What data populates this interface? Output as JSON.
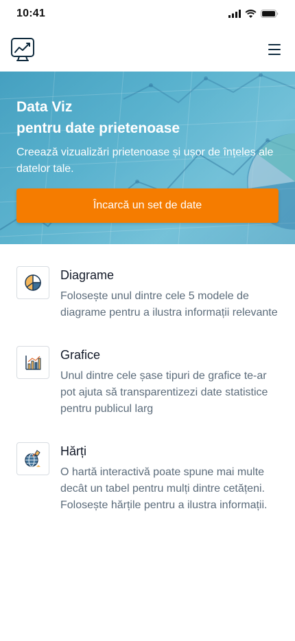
{
  "status": {
    "time": "10:41",
    "icons": [
      "signal-icon",
      "wifi-icon",
      "battery-icon"
    ]
  },
  "header": {
    "logo": "chart-monitor-logo-icon",
    "menu": "hamburger-menu-icon"
  },
  "hero": {
    "title_line1": "Data Viz",
    "title_line2": "pentru date prietenoase",
    "subtitle": "Creează vizualizări prietenoase și ușor de înțeles ale datelor tale.",
    "cta_label": "Încarcă un set de date",
    "cta_color": "#f57c00",
    "background_color": "#48aac9"
  },
  "features": [
    {
      "icon": "pie-chart-icon",
      "title": "Diagrame",
      "description": "Folosește unul dintre cele 5 modele de diagrame pentru a ilustra informații relevante"
    },
    {
      "icon": "bar-chart-icon",
      "title": "Grafice",
      "description": "Unul dintre cele șase tipuri de grafice te-ar pot ajuta să transparentizezi date statistice pentru publicul larg"
    },
    {
      "icon": "globe-map-icon",
      "title": "Hărți",
      "description": "O hartă interactivă poate spune mai multe decât un tabel pentru mulți dintre cetățeni. Folosește hărțile pentru a ilustra informații."
    }
  ]
}
